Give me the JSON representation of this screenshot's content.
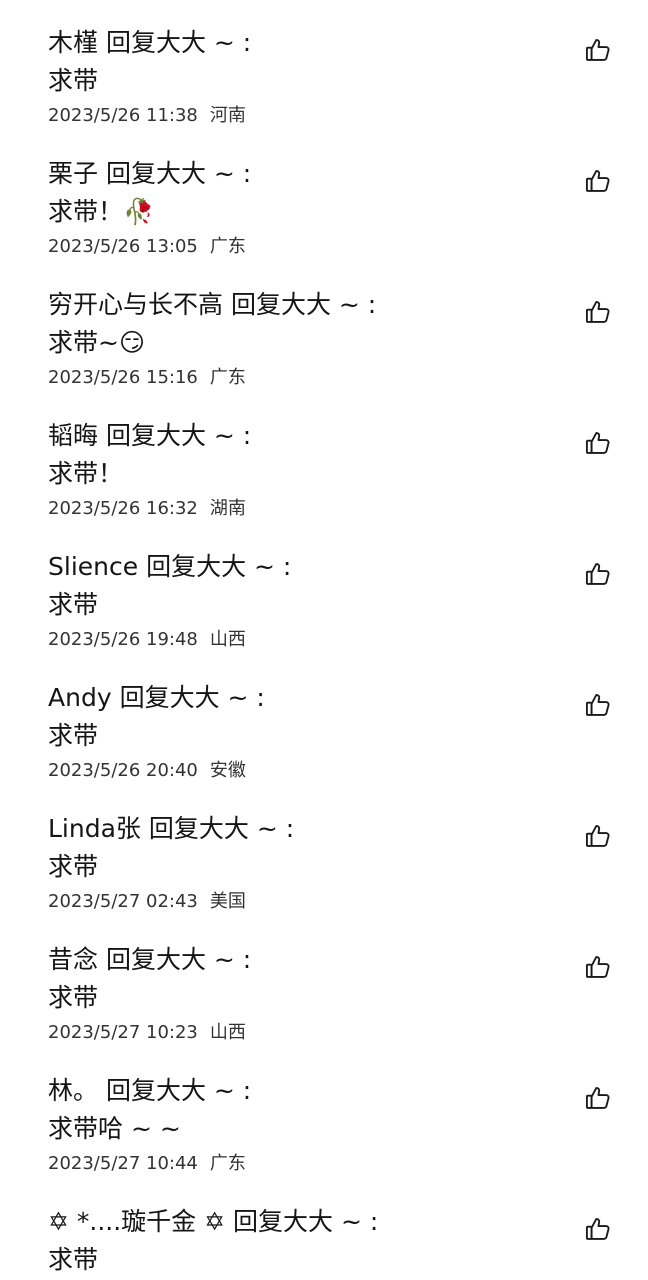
{
  "comments": [
    {
      "user": "木槿",
      "reply_to": "回复大大 ~ :",
      "text": "求带",
      "date": "2023/5/26 11:38",
      "location": "河南"
    },
    {
      "user": "栗子",
      "reply_to": "回复大大 ~ :",
      "text": "求带！🥀",
      "date": "2023/5/26 13:05",
      "location": "广东"
    },
    {
      "user": "穷开心与长不高",
      "reply_to": "回复大大 ~ :",
      "text": "求带~😏",
      "date": "2023/5/26 15:16",
      "location": "广东"
    },
    {
      "user": "韬晦",
      "reply_to": "回复大大 ~ :",
      "text": "求带！",
      "date": "2023/5/26 16:32",
      "location": "湖南"
    },
    {
      "user": "Slience",
      "reply_to": "回复大大 ~ :",
      "text": "求带",
      "date": "2023/5/26 19:48",
      "location": "山西"
    },
    {
      "user": "Andy",
      "reply_to": "回复大大 ~ :",
      "text": "求带",
      "date": "2023/5/26 20:40",
      "location": "安徽"
    },
    {
      "user": "Linda张",
      "reply_to": "回复大大 ~ :",
      "text": "求带",
      "date": "2023/5/27 02:43",
      "location": "美国"
    },
    {
      "user": "昔念",
      "reply_to": "回复大大 ~ :",
      "text": "求带",
      "date": "2023/5/27 10:23",
      "location": "山西"
    },
    {
      "user": "林。",
      "reply_to": "回复大大 ~ :",
      "text": "求带哈 ~ ~",
      "date": "2023/5/27 10:44",
      "location": "广东"
    },
    {
      "user": "✡ *....璇千金 ✡",
      "reply_to": "回复大大 ~ :",
      "text": "求带",
      "date": "",
      "location": ""
    }
  ],
  "icons": {
    "like": "thumbs-up-outline-icon"
  },
  "colors": {
    "text": "#151515",
    "meta": "#333333",
    "background": "#ffffff"
  }
}
